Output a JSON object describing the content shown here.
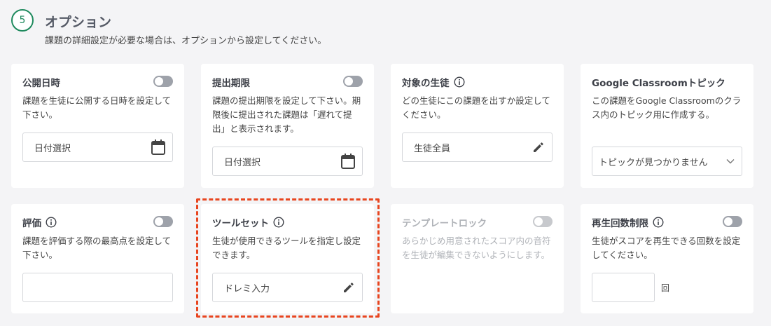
{
  "section": {
    "step_number": "5",
    "title": "オプション",
    "description": "課題の詳細設定が必要な場合は、オプションから設定してください。"
  },
  "cards": {
    "publish_date": {
      "title": "公開日時",
      "description": "課題を生徒に公開する日時を設定して下さい。",
      "field_value": "日付選択",
      "toggle": "off"
    },
    "due_date": {
      "title": "提出期限",
      "description": "課題の提出期限を設定して下さい。期限後に提出された課題は「遅れて提出」と表示されます。",
      "field_value": "日付選択",
      "toggle": "off"
    },
    "target_students": {
      "title": "対象の生徒",
      "description": "どの生徒にこの課題を出すか設定してください。",
      "field_value": "生徒全員"
    },
    "classroom_topic": {
      "title": "Google Classroomトピック",
      "description": "この課題をGoogle Classroomのクラス内のトピック用に作成する。",
      "selected_option": "トピックが見つかりません"
    },
    "grading": {
      "title": "評価",
      "description": "課題を評価する際の最高点を設定して下さい。",
      "field_value": "",
      "toggle": "off"
    },
    "toolset": {
      "title": "ツールセット",
      "description": "生徒が使用できるツールを指定し設定できます。",
      "field_value": "ドレミ入力"
    },
    "template_lock": {
      "title": "テンプレートロック",
      "description": "あらかじめ用意されたスコア内の音符を生徒が編集できないようにします。",
      "toggle": "off",
      "state": "disabled"
    },
    "playback_limit": {
      "title": "再生回数制限",
      "description": "生徒がスコアを再生できる回数を設定してください。",
      "field_value": "",
      "unit": "回",
      "toggle": "off"
    }
  },
  "icons": {
    "info": "info-circle-icon",
    "calendar": "calendar-icon",
    "edit": "pencil-icon",
    "dropdown": "chevron-down-icon"
  },
  "colors": {
    "accent_green": "#1f8a5e",
    "highlight_red": "#e8451f",
    "toggle_off": "#9ea2aa"
  }
}
